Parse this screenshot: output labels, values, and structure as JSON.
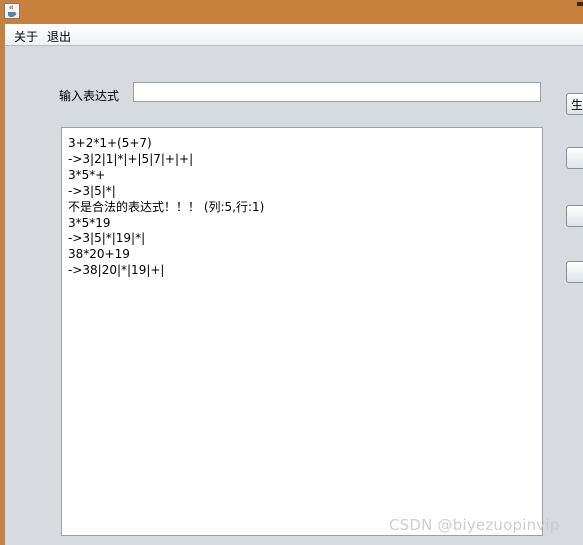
{
  "menu": {
    "items": [
      {
        "label": "关于"
      },
      {
        "label": "退出"
      }
    ]
  },
  "form": {
    "expression_label": "输入表达式",
    "expression_value": "",
    "expression_placeholder": ""
  },
  "buttons": [
    {
      "label": "生"
    },
    {
      "label": ""
    },
    {
      "label": ""
    },
    {
      "label": ""
    }
  ],
  "output": {
    "lines": [
      "3+2*1+(5+7)",
      "->3|2|1|*|+|5|7|+|+|",
      "3*5*+",
      "->3|5|*|",
      "不是合法的表达式！！！ (列:5,行:1)",
      "3*5*19",
      "->3|5|*|19|*|",
      "38*20+19",
      "->38|20|*|19|+|"
    ]
  },
  "watermark": {
    "text": "CSDN @biyezuopinvip"
  },
  "colors": {
    "title_bar": "#c8813c",
    "background": "#d7dade"
  },
  "icons": {
    "app": "java-coffee-icon"
  }
}
